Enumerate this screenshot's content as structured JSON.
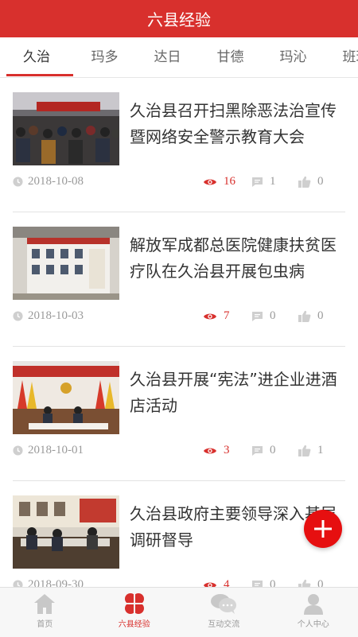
{
  "header": {
    "title": "六县经验"
  },
  "tabs": [
    "久治",
    "玛多",
    "达日",
    "甘德",
    "玛沁",
    "班玛"
  ],
  "articles": [
    {
      "title": "久治县召开扫黑除恶法治宣传暨网络安全警示教育大会",
      "date": "2018-10-08",
      "views": "16",
      "comments": "1",
      "likes": "0"
    },
    {
      "title": "解放军成都总医院健康扶贫医疗队在久治县开展包虫病",
      "date": "2018-10-03",
      "views": "7",
      "comments": "0",
      "likes": "0"
    },
    {
      "title": "久治县开展“宪法”进企业进酒店活动",
      "date": "2018-10-01",
      "views": "3",
      "comments": "0",
      "likes": "1"
    },
    {
      "title": "久治县政府主要领导深入基层调研督导",
      "date": "2018-09-30",
      "views": "4",
      "comments": "0",
      "likes": "0"
    }
  ],
  "bottom_nav": {
    "home": "首页",
    "experience": "六县经验",
    "interaction": "互动交流",
    "personal": "个人中心"
  },
  "colors": {
    "brand": "#d8302d",
    "fab": "#e60f10"
  },
  "icons": [
    "clock-icon",
    "eye-icon",
    "comment-icon",
    "thumb-up-icon",
    "plus-icon",
    "home-icon",
    "clover-icon",
    "chat-icon",
    "person-icon"
  ]
}
